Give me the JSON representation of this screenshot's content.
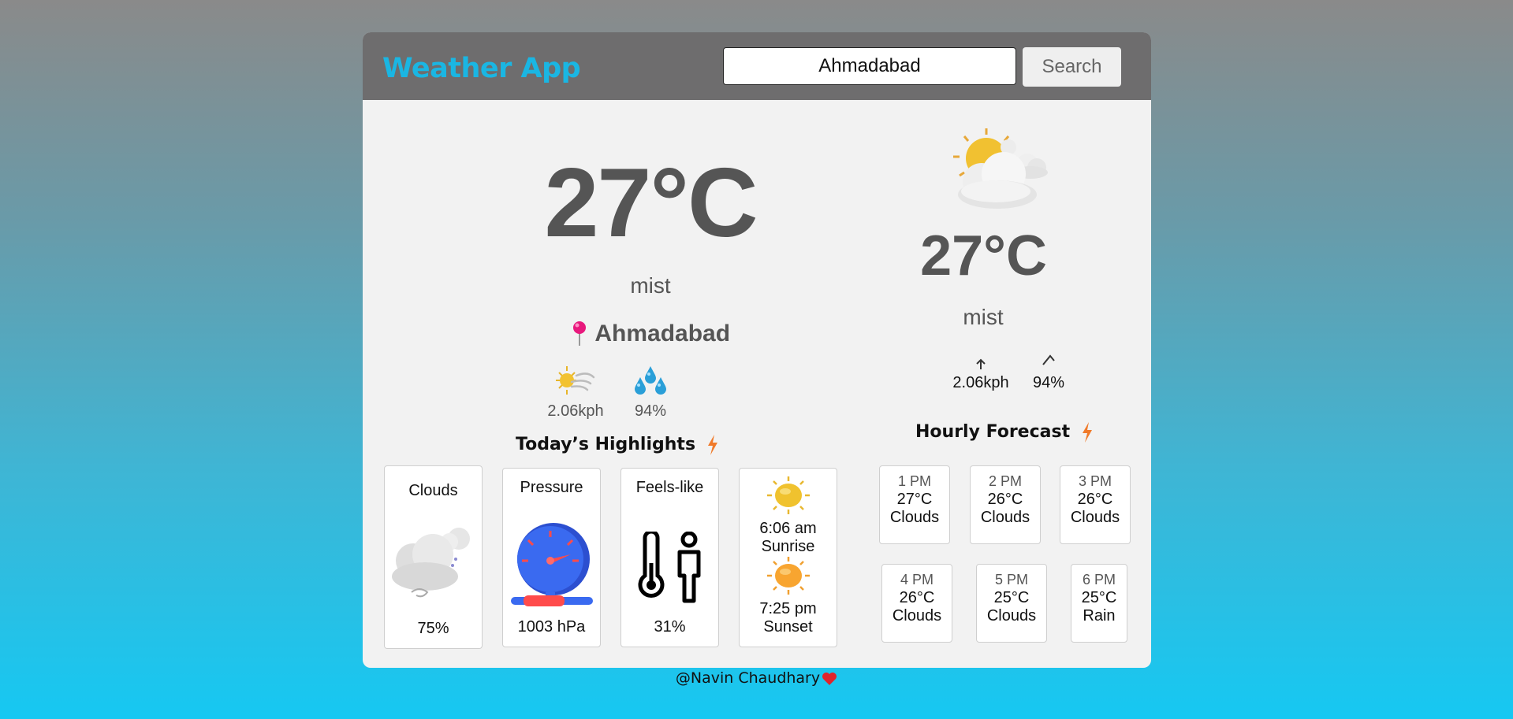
{
  "header": {
    "title": "Weather App",
    "search_value": "Ahmadabad",
    "search_button": "Search"
  },
  "current": {
    "temperature": "27°C",
    "description": "mist",
    "city": "Ahmadabad",
    "wind": "2.06kph",
    "humidity": "94%"
  },
  "highlights": {
    "title": "Today’s Highlights",
    "clouds": {
      "label": "Clouds",
      "value": "75%"
    },
    "pressure": {
      "label": "Pressure",
      "value": "1003 hPa"
    },
    "feels_like": {
      "label": "Feels-like",
      "value": "31%"
    },
    "sun": {
      "sunrise_time": "6:06 am",
      "sunrise_label": "Sunrise",
      "sunset_time": "7:25 pm",
      "sunset_label": "Sunset"
    }
  },
  "side": {
    "temperature": "27°C",
    "description": "mist",
    "wind": "2.06kph",
    "humidity": "94%"
  },
  "hourly": {
    "title": "Hourly Forecast",
    "items": [
      {
        "time": "1 PM",
        "temp": "27°C",
        "cond": "Clouds"
      },
      {
        "time": "2 PM",
        "temp": "26°C",
        "cond": "Clouds"
      },
      {
        "time": "3 PM",
        "temp": "26°C",
        "cond": "Clouds"
      },
      {
        "time": "4 PM",
        "temp": "26°C",
        "cond": "Clouds"
      },
      {
        "time": "5 PM",
        "temp": "25°C",
        "cond": "Clouds"
      },
      {
        "time": "6 PM",
        "temp": "25°C",
        "cond": "Rain"
      }
    ]
  },
  "footer": {
    "credit": "@Navin Chaudhary"
  },
  "colors": {
    "accent": "#1ab6e3",
    "header_bg": "#6e6d6e",
    "panel_bg": "#f2f2f2",
    "bolt": "#f07a2a",
    "heart": "#e0232b"
  },
  "icons": [
    "weather-partly-cloudy-icon",
    "pin-icon",
    "wind-sun-icon",
    "water-drops-icon",
    "lightning-bolt-icon",
    "cloud-icon",
    "pressure-gauge-icon",
    "thermometer-person-icon",
    "sunrise-icon",
    "sunset-icon",
    "arrow-up-icon",
    "chevron-up-icon",
    "heart-icon"
  ]
}
